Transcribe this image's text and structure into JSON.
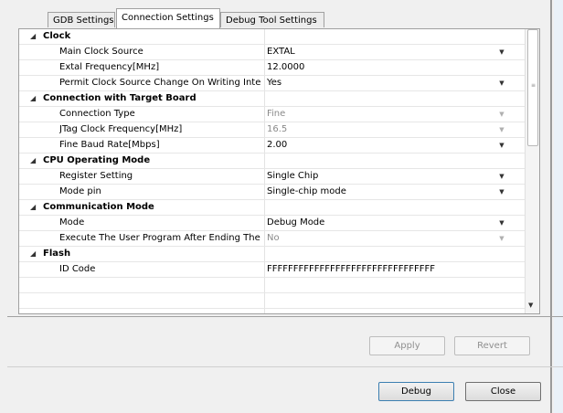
{
  "tabs": [
    {
      "label": "GDB Settings"
    },
    {
      "label": "Connection Settings"
    },
    {
      "label": "Debug Tool Settings"
    }
  ],
  "rows": [
    {
      "type": "category",
      "name": "Clock"
    },
    {
      "type": "property",
      "name": "Main Clock Source",
      "value": "EXTAL"
    },
    {
      "type": "property",
      "name": "Extal Frequency[MHz]",
      "value": "12.0000"
    },
    {
      "type": "property",
      "name": "Permit Clock Source Change On Writing Inte",
      "value": "Yes"
    },
    {
      "type": "category",
      "name": "Connection with Target Board"
    },
    {
      "type": "property",
      "name": "Connection Type",
      "value": "Fine"
    },
    {
      "type": "property",
      "name": "JTag Clock Frequency[MHz]",
      "value": "16.5"
    },
    {
      "type": "property",
      "name": "Fine Baud Rate[Mbps]",
      "value": "2.00"
    },
    {
      "type": "category",
      "name": "CPU Operating Mode"
    },
    {
      "type": "property",
      "name": "Register Setting",
      "value": "Single Chip"
    },
    {
      "type": "property",
      "name": "Mode pin",
      "value": "Single-chip mode"
    },
    {
      "type": "category",
      "name": "Communication Mode"
    },
    {
      "type": "property",
      "name": "Mode",
      "value": "Debug Mode"
    },
    {
      "type": "property",
      "name": "Execute The User Program After Ending The",
      "value": "No"
    },
    {
      "type": "category",
      "name": "Flash"
    },
    {
      "type": "property",
      "name": "ID Code",
      "value": "FFFFFFFFFFFFFFFFFFFFFFFFFFFFFFFF"
    }
  ],
  "buttons": {
    "apply_label": "Apply",
    "revert_label": "Revert",
    "debug_label": "Debug",
    "close_label": "Close"
  }
}
